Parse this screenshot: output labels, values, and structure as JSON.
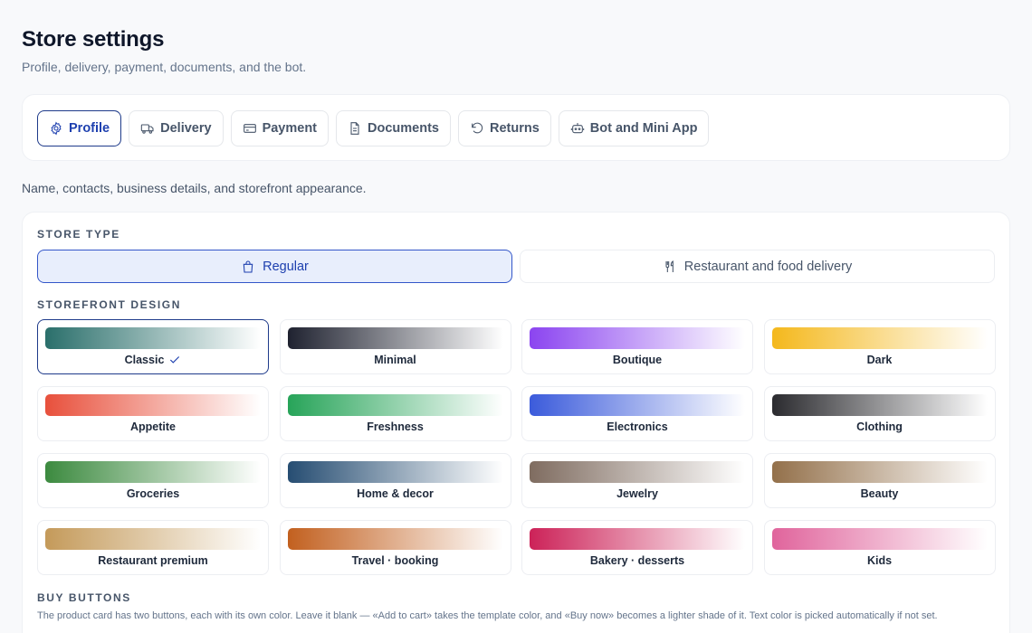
{
  "header": {
    "title": "Store settings",
    "subtitle": "Profile, delivery, payment, documents, and the bot."
  },
  "tabs": [
    {
      "label": "Profile",
      "icon": "gear-icon",
      "active": true
    },
    {
      "label": "Delivery",
      "icon": "truck-icon",
      "active": false
    },
    {
      "label": "Payment",
      "icon": "credit-card-icon",
      "active": false
    },
    {
      "label": "Documents",
      "icon": "document-icon",
      "active": false
    },
    {
      "label": "Returns",
      "icon": "undo-icon",
      "active": false
    },
    {
      "label": "Bot and Mini App",
      "icon": "bot-icon",
      "active": false
    }
  ],
  "section_description": "Name, contacts, business details, and storefront appearance.",
  "store_type": {
    "label": "STORE TYPE",
    "options": [
      {
        "label": "Regular",
        "icon": "shopping-bag-icon",
        "active": true
      },
      {
        "label": "Restaurant and food delivery",
        "icon": "utensils-icon",
        "active": false
      }
    ]
  },
  "storefront_design": {
    "label": "STOREFRONT DESIGN",
    "designs": [
      {
        "name": "Classic",
        "from": "#2a6f6b",
        "to": "#ffffff",
        "active": true
      },
      {
        "name": "Minimal",
        "from": "#1f2230",
        "to": "#ffffff",
        "active": false
      },
      {
        "name": "Boutique",
        "from": "#8b44f0",
        "to": "#ffffff",
        "active": false
      },
      {
        "name": "Dark",
        "from": "#f4b81c",
        "to": "#ffffff",
        "active": false
      },
      {
        "name": "Appetite",
        "from": "#e8503c",
        "to": "#ffffff",
        "active": false
      },
      {
        "name": "Freshness",
        "from": "#27a459",
        "to": "#ffffff",
        "active": false
      },
      {
        "name": "Electronics",
        "from": "#3b5bdb",
        "to": "#ffffff",
        "active": false
      },
      {
        "name": "Clothing",
        "from": "#2b2b2f",
        "to": "#ffffff",
        "active": false
      },
      {
        "name": "Groceries",
        "from": "#3c8a3f",
        "to": "#ffffff",
        "active": false
      },
      {
        "name": "Home & decor",
        "from": "#264d72",
        "to": "#ffffff",
        "active": false
      },
      {
        "name": "Jewelry",
        "from": "#7f6c60",
        "to": "#ffffff",
        "active": false
      },
      {
        "name": "Beauty",
        "from": "#93704a",
        "to": "#ffffff",
        "active": false
      },
      {
        "name": "Restaurant premium",
        "from": "#c49a5a",
        "to": "#ffffff",
        "active": false
      },
      {
        "name": "Travel · booking",
        "from": "#c2601f",
        "to": "#ffffff",
        "active": false
      },
      {
        "name": "Bakery · desserts",
        "from": "#cc2258",
        "to": "#ffffff",
        "active": false
      },
      {
        "name": "Kids",
        "from": "#e0649c",
        "to": "#ffffff",
        "active": false
      }
    ]
  },
  "buy_buttons": {
    "label": "BUY BUTTONS",
    "description": "The product card has two buttons, each with its own color. Leave it blank — «Add to cart» takes the template color, and «Buy now» becomes a lighter shade of it. Text color is picked automatically if not set."
  },
  "colors": {
    "accent": "#1e40af",
    "accent_border": "#1e3a8a",
    "active_bg": "#e8eefc"
  }
}
